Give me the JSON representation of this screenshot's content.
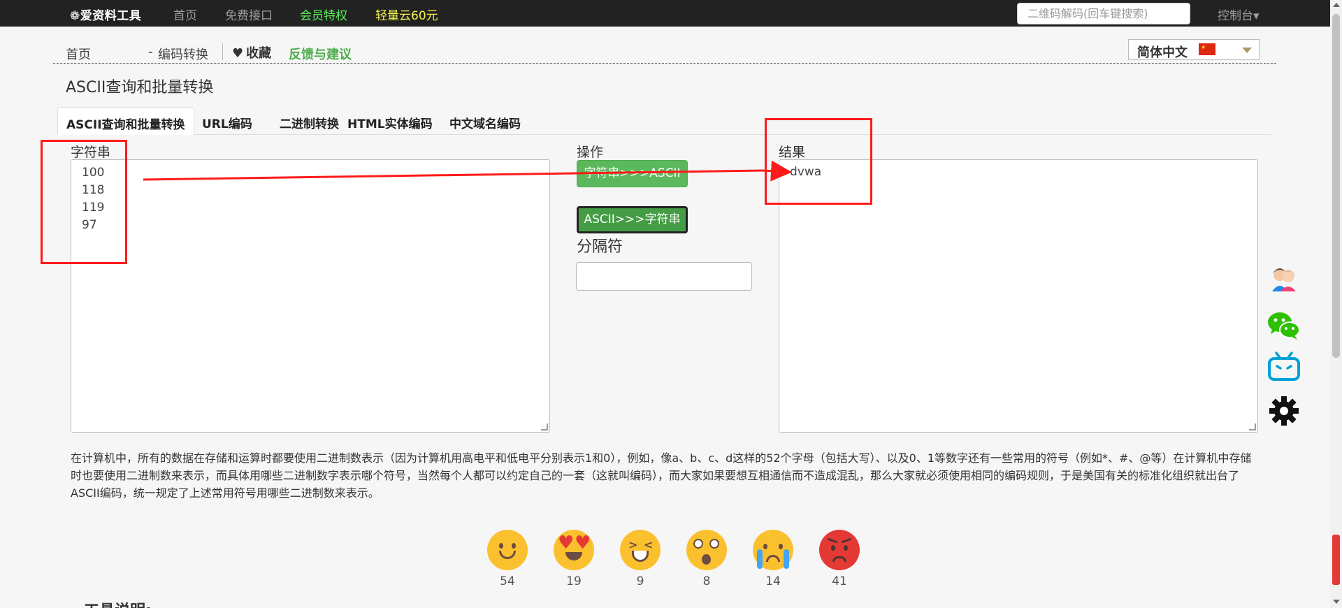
{
  "nav": {
    "logo": "❁爱资料工具",
    "items": [
      {
        "label": "首页"
      },
      {
        "label": "免费接口"
      },
      {
        "label": "会员特权"
      },
      {
        "label": "轻量云60元"
      }
    ],
    "search_placeholder": "二维码解码(回车键搜索)",
    "console": "控制台▾"
  },
  "breadcrumb": {
    "home": "首页",
    "sep": "-",
    "current": "编码转换"
  },
  "favorite": "收藏",
  "feedback": "反馈与建议",
  "language": {
    "label": "简体中文"
  },
  "page_title": "ASCII查询和批量转换",
  "tabs": [
    {
      "label": "ASCII查询和批量转换"
    },
    {
      "label": "URL编码"
    },
    {
      "label": "二进制转换"
    },
    {
      "label": "HTML实体编码"
    },
    {
      "label": "中文域名编码"
    }
  ],
  "input": {
    "label": "字符串",
    "lines": [
      "100",
      "118",
      "119",
      "97"
    ]
  },
  "ops": {
    "label": "操作",
    "btn_to_ascii": "字符串>>>ASCII",
    "btn_to_string": "ASCII>>>字符串",
    "separator_label": "分隔符",
    "separator_value": ""
  },
  "result": {
    "label": "结果",
    "value": "dvwa"
  },
  "description": "在计算机中，所有的数据在存储和运算时都要使用二进制数表示（因为计算机用高电平和低电平分别表示1和0），例如，像a、b、c、d这样的52个字母（包括大写）、以及0、1等数字还有一些常用的符号（例如*、#、@等）在计算机中存储时也要使用二进制数来表示，而具体用哪些二进制数字表示哪个符号，当然每个人都可以约定自己的一套（这就叫编码），而大家如果要想互相通信而不造成混乱，那么大家就必须使用相同的编码规则，于是美国有关的标准化组织就出台了ASCII编码，统一规定了上述常用符号用哪些二进制数来表示。",
  "reactions": [
    {
      "icon": "smile-emoji",
      "count": "54"
    },
    {
      "icon": "heart-eyes-emoji",
      "count": "19"
    },
    {
      "icon": "laughing-emoji",
      "count": "9"
    },
    {
      "icon": "astonished-emoji",
      "count": "8"
    },
    {
      "icon": "crying-emoji",
      "count": "14"
    },
    {
      "icon": "angry-emoji",
      "count": "41"
    }
  ],
  "bottom_heading": "工具说明:",
  "colors": {
    "nav_bg": "#222222",
    "green": "#5cb85c",
    "annotation": "#ff1a1a"
  }
}
